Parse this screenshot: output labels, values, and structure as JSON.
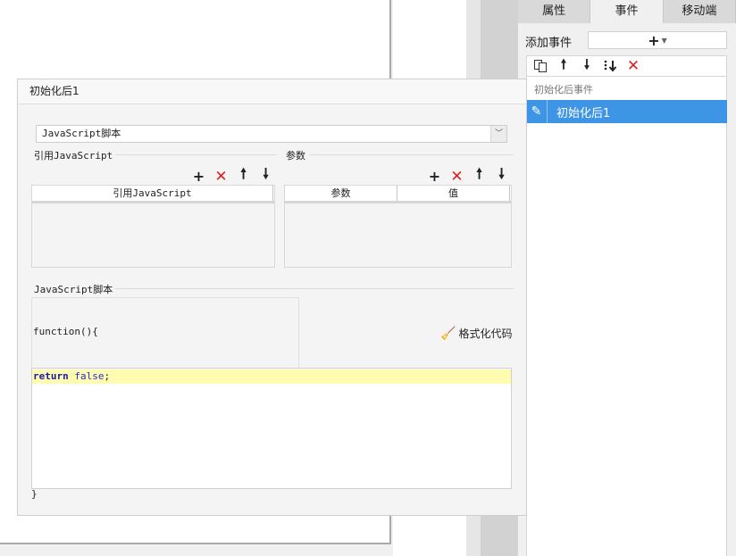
{
  "right_panel": {
    "tabs": [
      "属性",
      "事件",
      "移动端"
    ],
    "active_tab": "事件",
    "add_event_label": "添加事件",
    "add_event_button": "+",
    "toolbar_icons": [
      "copy-icon",
      "move-up-icon",
      "move-down-icon",
      "move-bottom-icon",
      "delete-icon"
    ],
    "event_group": "初始化后事件",
    "selected_event": "初始化后1"
  },
  "dialog": {
    "title": "初始化后1",
    "type_select": "JavaScript脚本",
    "refs": {
      "label": "引用JavaScript",
      "column": "引用JavaScript"
    },
    "params": {
      "label": "参数",
      "columns": [
        "参数",
        "值"
      ]
    },
    "script_label": "JavaScript脚本",
    "code_prefix": "function(){",
    "format_button": "格式化代码",
    "code_return_kw": "return",
    "code_false": "false",
    "code_semicolon": ";",
    "code_suffix": "}"
  },
  "colors": {
    "selection": "#3e95e6",
    "delete_red": "#e02020",
    "code_highlight": "#fffbb0"
  }
}
